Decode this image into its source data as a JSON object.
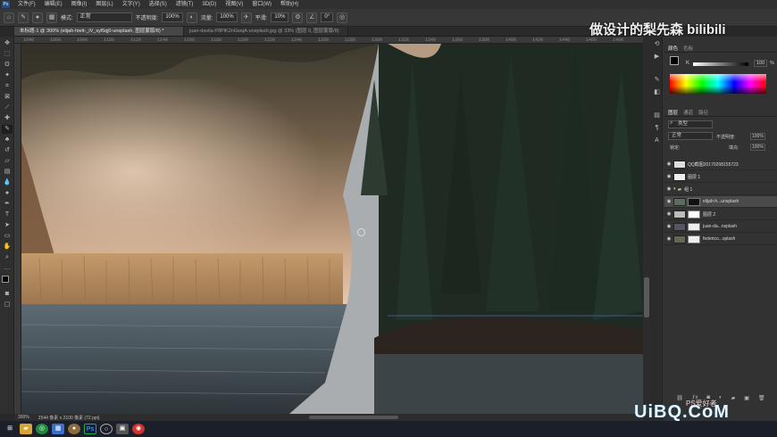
{
  "menubar": {
    "items": [
      "文件(F)",
      "编辑(E)",
      "图像(I)",
      "图层(L)",
      "文字(Y)",
      "选择(S)",
      "滤镜(T)",
      "3D(D)",
      "视图(V)",
      "窗口(W)",
      "帮助(H)"
    ]
  },
  "options": {
    "mode_label": "模式:",
    "mode_value": "正常",
    "opacity_label": "不透明度:",
    "opacity_value": "100%",
    "flow_label": "流量:",
    "flow_value": "100%",
    "smooth_label": "平滑:",
    "smooth_value": "10%",
    "angle_value": "0°"
  },
  "tabs": [
    {
      "label": "未标题-1 @ 300% (elijah-hiett-_iV_syl5qj0-unsplash, 图层蒙版/8) *"
    },
    {
      "label": "juan-davila-P8PlK2nGwqA-unsplash.jpg @ 33% (图层 0, 图层蒙版/8)"
    }
  ],
  "ruler": {
    "ticks": [
      "1040",
      "1060",
      "1080",
      "1100",
      "1120",
      "1140",
      "1160",
      "1180",
      "1200",
      "1220",
      "1240",
      "1260",
      "1280",
      "1300",
      "1320",
      "1340",
      "1360",
      "1380",
      "1400",
      "1420",
      "1440",
      "1460",
      "1480"
    ]
  },
  "status": {
    "zoom": "300%",
    "doc_size": "2544 像素 x 2100 像素 (72 ppi)"
  },
  "color": {
    "foreground": "#000000",
    "background": "#ffffff",
    "slider_label": "K",
    "slider_value": "100",
    "slider_unit": "%"
  },
  "color_panel_tabs": [
    "颜色",
    "色板"
  ],
  "layers_panel": {
    "tabs": [
      "图层",
      "通道",
      "路径"
    ],
    "filter_value": "类型",
    "blend_mode": "正常",
    "opacity_label": "不透明度:",
    "opacity_value": "100%",
    "lock_label": "锁定:",
    "fill_label": "填充:",
    "fill_value": "100%",
    "layers": [
      {
        "name": "QQ截图20170208155723"
      },
      {
        "name": "图层 1"
      },
      {
        "name": "组 1"
      },
      {
        "name": "elijah-h...unsplash"
      },
      {
        "name": "图层 2"
      },
      {
        "name": "juan-da...nsplash"
      },
      {
        "name": "federico...splash"
      }
    ]
  },
  "watermarks": {
    "top": "做设计的梨先森 bilibili",
    "bottom_logo": "UiBQ.CoM",
    "bottom_small": "PS爱好者"
  },
  "colors": {
    "accent": "#2b6cd8",
    "panel": "#323232"
  }
}
